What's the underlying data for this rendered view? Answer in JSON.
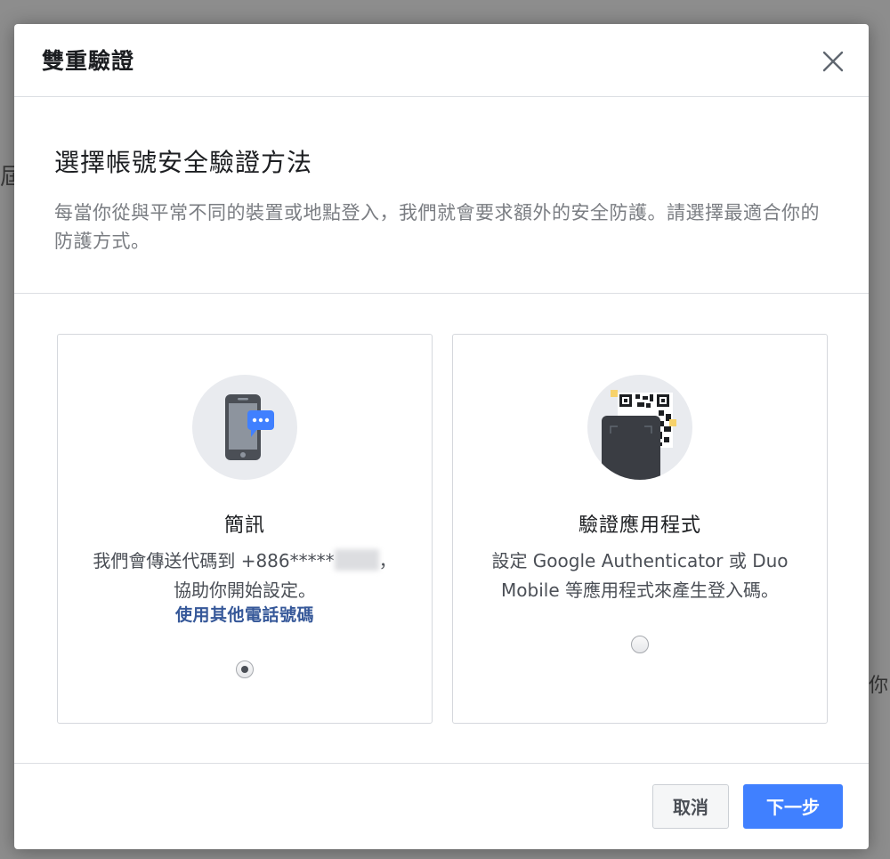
{
  "background": {
    "frag_left": "屆",
    "frag_right": "你"
  },
  "dialog": {
    "title": "雙重驗證",
    "close_icon": "close-icon"
  },
  "intro": {
    "heading": "選擇帳號安全驗證方法",
    "description": "每當你從與平常不同的裝置或地點登入，我們就會要求額外的安全防護。請選擇最適合你的防護方式。"
  },
  "options": [
    {
      "icon": "phone-message-icon",
      "title": "簡訊",
      "desc_line1": "我們會傳送代碼到 +886*****",
      "desc_comma": "，",
      "desc_line2": "協助你開始設定。",
      "link": "使用其他電話號碼",
      "selected": true
    },
    {
      "icon": "qr-code-phone-icon",
      "title": "驗證應用程式",
      "description": "設定 Google Authenticator 或 Duo Mobile 等應用程式來產生登入碼。",
      "selected": false
    }
  ],
  "footer": {
    "cancel_label": "取消",
    "next_label": "下一步"
  },
  "colors": {
    "primary": "#4080ff",
    "link": "#365899",
    "text": "#1c1e21",
    "muted": "#7a7d82"
  }
}
